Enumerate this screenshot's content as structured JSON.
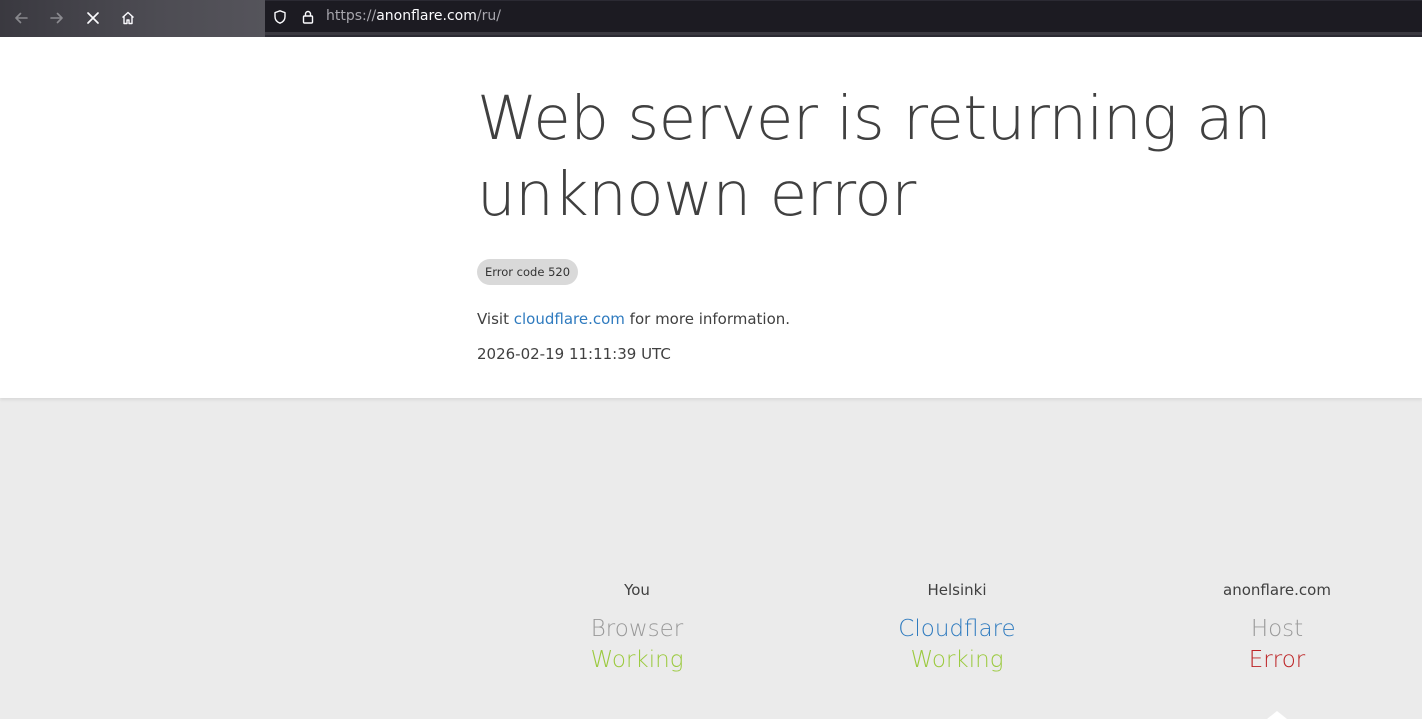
{
  "browser": {
    "url_prefix": "https://",
    "url_host": "anonflare.com",
    "url_path": "/ru/",
    "icons": [
      "back-arrow-icon",
      "forward-arrow-icon",
      "stop-icon",
      "home-icon",
      "tracking-shield-icon",
      "lock-icon"
    ]
  },
  "page": {
    "headline": "Web server is returning an unknown error",
    "error_code": "Error code 520",
    "visit_prefix": "Visit",
    "visit_link": "cloudflare.com",
    "visit_suffix": "for more information.",
    "timestamp": "2026-02-19 11:11:39 UTC"
  },
  "status": [
    {
      "location": "You",
      "name": "Browser",
      "state": "Working",
      "name_color": "#999999",
      "state_color": "#9bca3e"
    },
    {
      "location": "Helsinki",
      "name": "Cloudflare",
      "state": "Working",
      "name_color": "#2f7bbf",
      "state_color": "#9bca3e"
    },
    {
      "location": "anonflare.com",
      "name": "Host",
      "state": "Error",
      "name_color": "#999999",
      "state_color": "#bd2426"
    }
  ],
  "colors": {
    "link": "#2f7bbf",
    "working": "#9bca3e",
    "error": "#bd2426",
    "gray_label": "#999999"
  }
}
